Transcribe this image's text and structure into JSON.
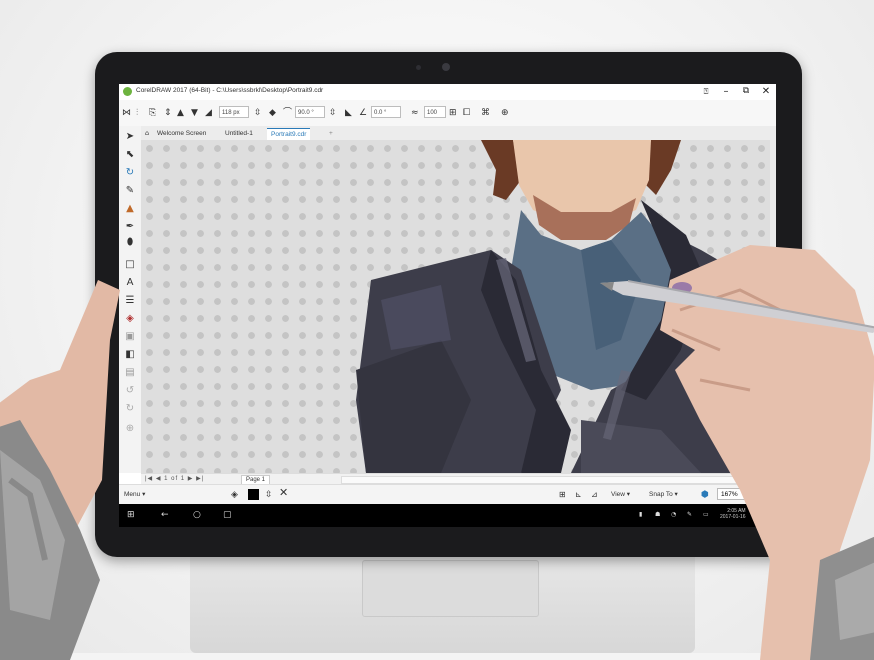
{
  "window": {
    "title": "CorelDRAW 2017 (64-Bit) - C:\\Users\\ssbrkl\\Desktop\\Portrait9.cdr",
    "minimize_glyph": "–",
    "restore_glyph": "⧉",
    "close_glyph": "✕"
  },
  "property_bar": {
    "width_value": "118 px",
    "rotation_value": "90.0 °",
    "angle_value": "0.0 °",
    "opacity_value": "100"
  },
  "tabs": [
    {
      "label": "Welcome Screen"
    },
    {
      "label": "Untitled-1"
    },
    {
      "label": "Portrait9.cdr"
    }
  ],
  "add_tab_glyph": "+",
  "page_nav": {
    "controls": "|◀ ◀ 1 of 1 ▶ ▶|",
    "page_label": "Page 1"
  },
  "status_bar": {
    "menu_label": "Menu",
    "view_label": "View",
    "snap_label": "Snap To",
    "zoom_value": "167%"
  },
  "taskbar": {
    "date_line1": "2:05 AM",
    "date_line2": "2017-01-16"
  },
  "icons": {
    "tools": [
      "pick-tool-icon",
      "shape-tool-icon",
      "crop-tool-icon",
      "zoom-tool-icon",
      "freehand-tool-icon",
      "artistic-media-icon",
      "rectangle-tool-icon",
      "ellipse-tool-icon",
      "polygon-tool-icon",
      "text-tool-icon",
      "parallel-dimension-icon",
      "connector-icon",
      "drop-shadow-icon",
      "transparency-icon",
      "color-eyedropper-icon",
      "interactive-fill-icon",
      "smart-fill-icon"
    ]
  },
  "colors": {
    "accent": "#2a7ab8",
    "coreldraw_green": "#6db33f",
    "jacket": "#3d3d4a",
    "shirt": "#5a6f85",
    "skin": "#e9c6ab",
    "hair": "#6a3a25"
  }
}
